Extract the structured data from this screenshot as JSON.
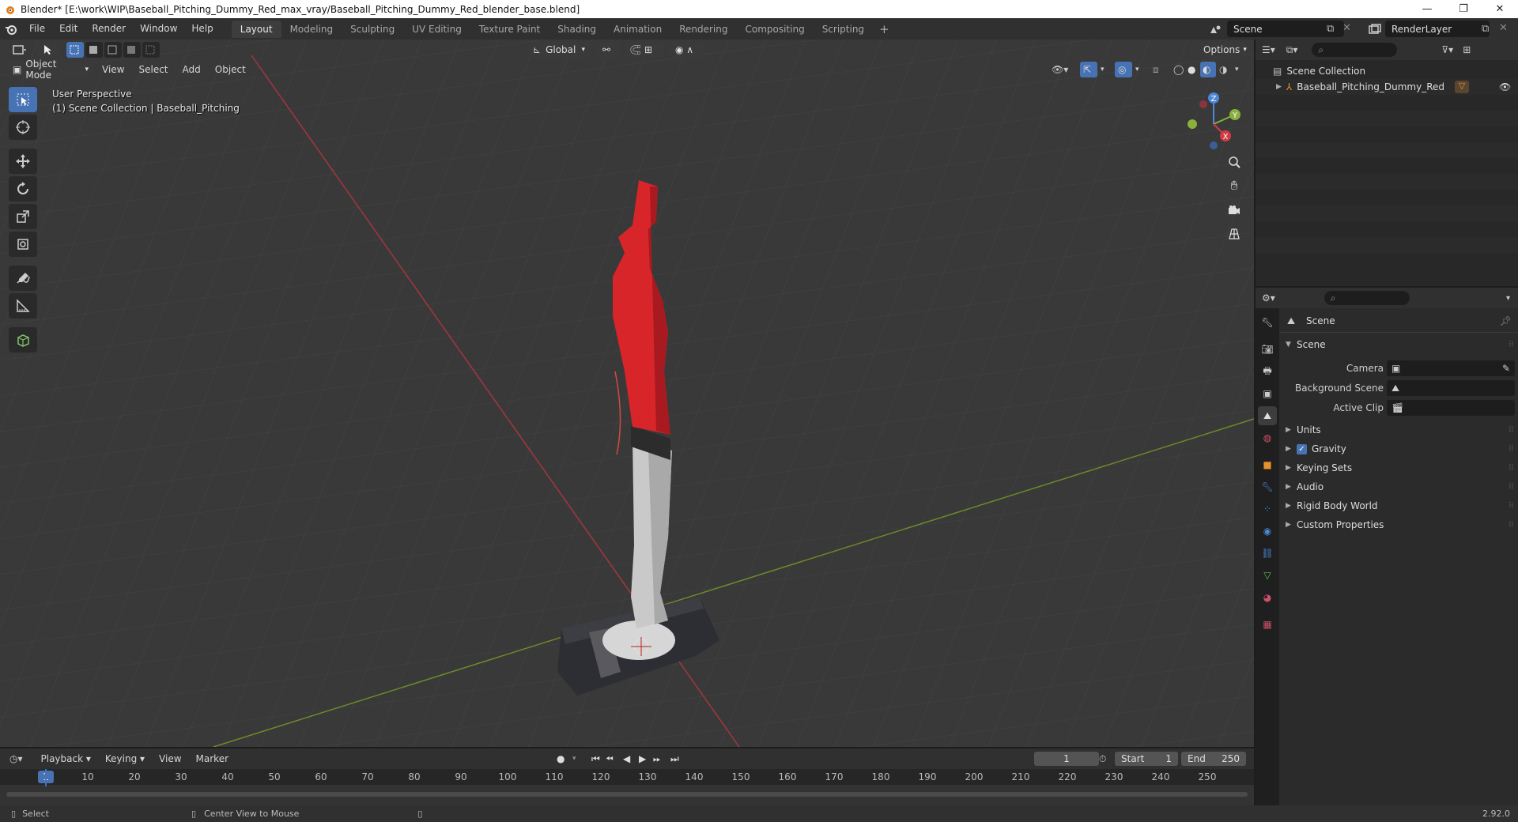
{
  "titlebar": {
    "title": "Blender* [E:\\work\\WIP\\Baseball_Pitching_Dummy_Red_max_vray/Baseball_Pitching_Dummy_Red_blender_base.blend]",
    "minimize": "—",
    "restore": "❐",
    "close": "✕"
  },
  "menubar": {
    "items": [
      "File",
      "Edit",
      "Render",
      "Window",
      "Help"
    ],
    "tabs": [
      "Layout",
      "Modeling",
      "Sculpting",
      "UV Editing",
      "Texture Paint",
      "Shading",
      "Animation",
      "Rendering",
      "Compositing",
      "Scripting"
    ],
    "active_tab": "Layout",
    "add_tab": "+",
    "scene": "Scene",
    "render_layer": "RenderLayer"
  },
  "viewport": {
    "transform_orientation": "Global",
    "options": "Options",
    "mode": "Object Mode",
    "menus": [
      "View",
      "Select",
      "Add",
      "Object"
    ],
    "info_line1": "User Perspective",
    "info_line2": "(1) Scene Collection | Baseball_Pitching",
    "gizmo": {
      "x": "X",
      "y": "Y",
      "z": "Z"
    }
  },
  "outliner": {
    "search_placeholder": "",
    "root": "Scene Collection",
    "items": [
      {
        "name": "Baseball_Pitching_Dummy_Red"
      }
    ]
  },
  "properties": {
    "context": "Scene",
    "panel_title": "Scene",
    "fields": [
      {
        "label": "Camera",
        "value": ""
      },
      {
        "label": "Background Scene",
        "value": ""
      },
      {
        "label": "Active Clip",
        "value": ""
      }
    ],
    "subpanels": [
      "Units",
      "Gravity",
      "Keying Sets",
      "Audio",
      "Rigid Body World",
      "Custom Properties"
    ],
    "gravity_checked": true
  },
  "timeline": {
    "menus": [
      "Playback",
      "Keying",
      "View",
      "Marker"
    ],
    "current_frame": "1",
    "start_label": "Start",
    "start_value": "1",
    "end_label": "End",
    "end_value": "250",
    "ruler": [
      "10",
      "20",
      "30",
      "40",
      "50",
      "60",
      "70",
      "80",
      "90",
      "100",
      "110",
      "120",
      "130",
      "140",
      "150",
      "160",
      "170",
      "180",
      "190",
      "200",
      "210",
      "220",
      "230",
      "240",
      "250"
    ],
    "marker_frame": "1"
  },
  "statusbar": {
    "left": "Select",
    "middle": "Center View to Mouse",
    "version": "2.92.0"
  },
  "colors": {
    "accent": "#4772b3",
    "x_axis": "#c8303a",
    "y_axis": "#6c9a2e",
    "dummy_red": "#d7252a",
    "dummy_gray": "#c8c8c8"
  }
}
